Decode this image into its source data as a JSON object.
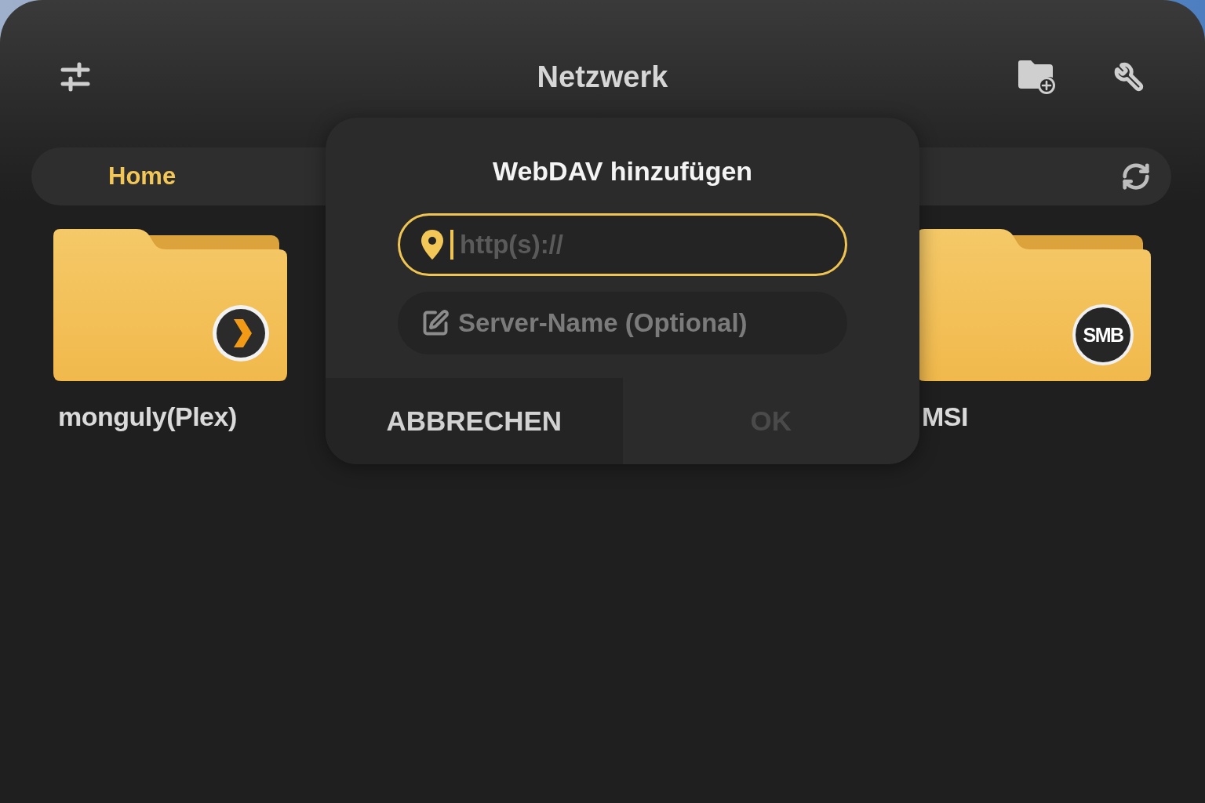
{
  "header": {
    "title": "Netzwerk"
  },
  "breadcrumb": {
    "items": [
      {
        "label": "Home",
        "selected": true
      }
    ]
  },
  "folders": [
    {
      "name": "monguly(Plex)",
      "kind": "plex"
    },
    {
      "name": "MSI",
      "kind": "smb",
      "badge": "SMB"
    }
  ],
  "dialog": {
    "title": "WebDAV hinzufügen",
    "fields": [
      {
        "kind": "url",
        "placeholder": "http(s)://",
        "focused": true
      },
      {
        "kind": "name",
        "placeholder": "Server-Name (Optional)",
        "focused": false
      }
    ],
    "buttons": [
      {
        "label": "ABBRECHEN",
        "disabled": false
      },
      {
        "label": "OK",
        "disabled": true
      }
    ]
  }
}
